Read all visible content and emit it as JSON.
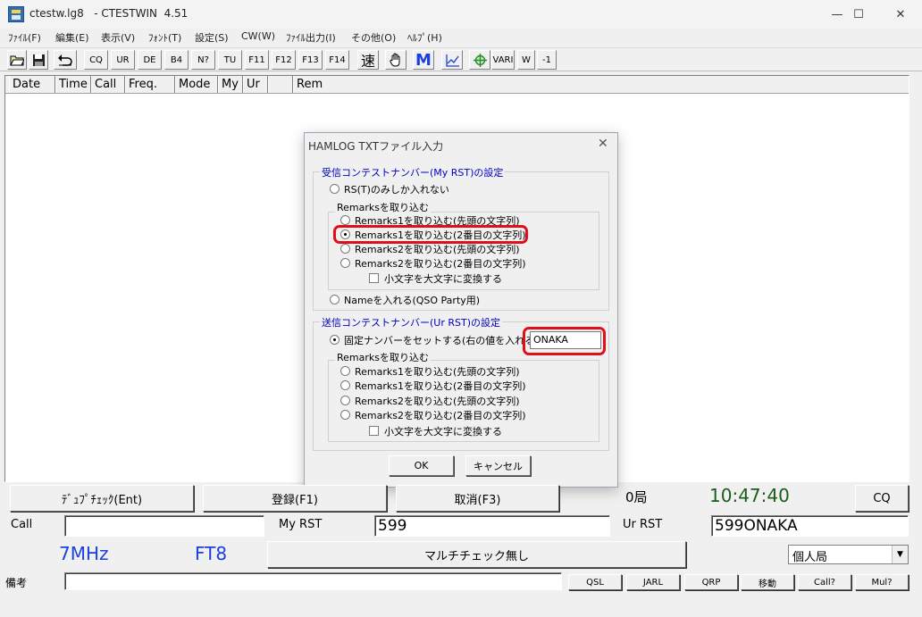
{
  "window": {
    "title": "ctestw.lg8   - CTESTWIN  4.51",
    "minimize": "—",
    "maximize": "☐",
    "close": "✕"
  },
  "menu": [
    "ﾌｧｲﾙ(F)",
    "編集(E)",
    "表示(V)",
    "ﾌｫﾝﾄ(T)",
    "設定(S)",
    "CW(W)",
    "ﾌｧｲﾙ出力(I)",
    "その他(O)",
    "ﾍﾙﾌﾟ(H)"
  ],
  "toolbar": {
    "text_buttons": [
      "CQ",
      "UR",
      "DE",
      "B4",
      "N?",
      "TU",
      "F11",
      "F12",
      "F13",
      "F14"
    ],
    "speed_label": "速",
    "m_label": "M",
    "vari_label": "VARI",
    "w_label": "W",
    "minus1_label": "-1",
    "icons": [
      "open-folder-icon",
      "save-disk-icon",
      "undo-icon",
      "hand-icon",
      "graph-icon",
      "rotate-icon"
    ]
  },
  "log_columns": [
    "Date",
    "Time",
    "Call",
    "Freq.",
    "Mode",
    "My",
    "Ur",
    "",
    "Rem"
  ],
  "dialog": {
    "title": "HAMLOG TXTファイル入力",
    "close": "✕",
    "recv_group_title": "受信コンテストナンバー(My RST)の設定",
    "recv_opt_rst_only": "RS(T)のみしか入れない",
    "recv_remarks_group": "Remarksを取り込む",
    "recv_remarks_options": [
      "Remarks1を取り込む(先頭の文字列)",
      "Remarks1を取り込む(2番目の文字列)",
      "Remarks2を取り込む(先頭の文字列)",
      "Remarks2を取り込む(2番目の文字列)"
    ],
    "recv_selected_index": 1,
    "recv_uppercase": "小文字を大文字に変換する",
    "recv_opt_name": "Nameを入れる(QSO Party用)",
    "send_group_title": "送信コンテストナンバー(Ur RST)の設定",
    "send_opt_fixed": "固定ナンバーをセットする(右の値を入れる)",
    "send_fixed_value": "ONAKA",
    "send_remarks_group": "Remarksを取り込む",
    "send_remarks_options": [
      "Remarks1を取り込む(先頭の文字列)",
      "Remarks1を取り込む(2番目の文字列)",
      "Remarks2を取り込む(先頭の文字列)",
      "Remarks2を取り込む(2番目の文字列)"
    ],
    "send_uppercase": "小文字を大文字に変換する",
    "ok": "OK",
    "cancel": "キャンセル"
  },
  "bottom": {
    "dupe_check": "ﾃﾞｭﾌﾟﾁｪｯｸ(Ent)",
    "register": "登録(F1)",
    "cancel": "取消(F3)",
    "station_count": "0局",
    "time": "10:47:40",
    "cq_button": "CQ",
    "call_label": "Call",
    "call_value": "",
    "my_rst_label": "My RST",
    "my_rst_value": "599",
    "ur_rst_label": "Ur RST",
    "ur_rst_value": "599ONAKA",
    "band": "7MHz",
    "mode": "FT8",
    "multi_check": "マルチチェック無し",
    "station_type": "個人局",
    "remarks_label": "備考",
    "remarks_value": "",
    "small_buttons": [
      "QSL",
      "JARL",
      "QRP",
      "移動",
      "Call?",
      "Mul?"
    ]
  },
  "colors": {
    "time_green": "#1a5c1a",
    "band_blue": "#1a3fe0",
    "highlight_red": "#e0101a",
    "dialog_group_blue": "#0000c0"
  }
}
